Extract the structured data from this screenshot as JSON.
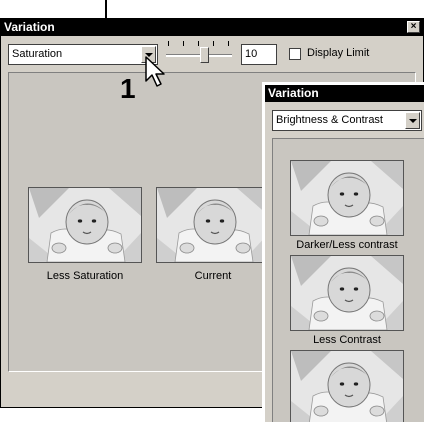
{
  "main_window": {
    "title": "Variation",
    "close_glyph": "×",
    "mode_select": {
      "value": "Saturation"
    },
    "slider": {
      "value": 0.6
    },
    "amount_input": {
      "value": "10"
    },
    "display_limit": {
      "label": "Display Limit",
      "checked": false
    },
    "thumbnails": [
      {
        "caption": "Less Saturation"
      },
      {
        "caption": "Current"
      }
    ]
  },
  "overlay_window": {
    "title": "Variation",
    "mode_select": {
      "value": "Brightness & Contrast"
    },
    "thumbnails": [
      {
        "caption": "Darker/Less contrast"
      },
      {
        "caption": "Less Contrast"
      },
      {
        "caption": ""
      }
    ]
  },
  "annotation": {
    "step_number": "1"
  },
  "icons": [
    "close-icon",
    "chevron-down-icon",
    "mouse-pointer-icon",
    "baby-photo"
  ],
  "colors": {
    "titlebar": "#000000",
    "window_bg": "#d4d0c8",
    "panel_bg": "#c9c6c0"
  }
}
